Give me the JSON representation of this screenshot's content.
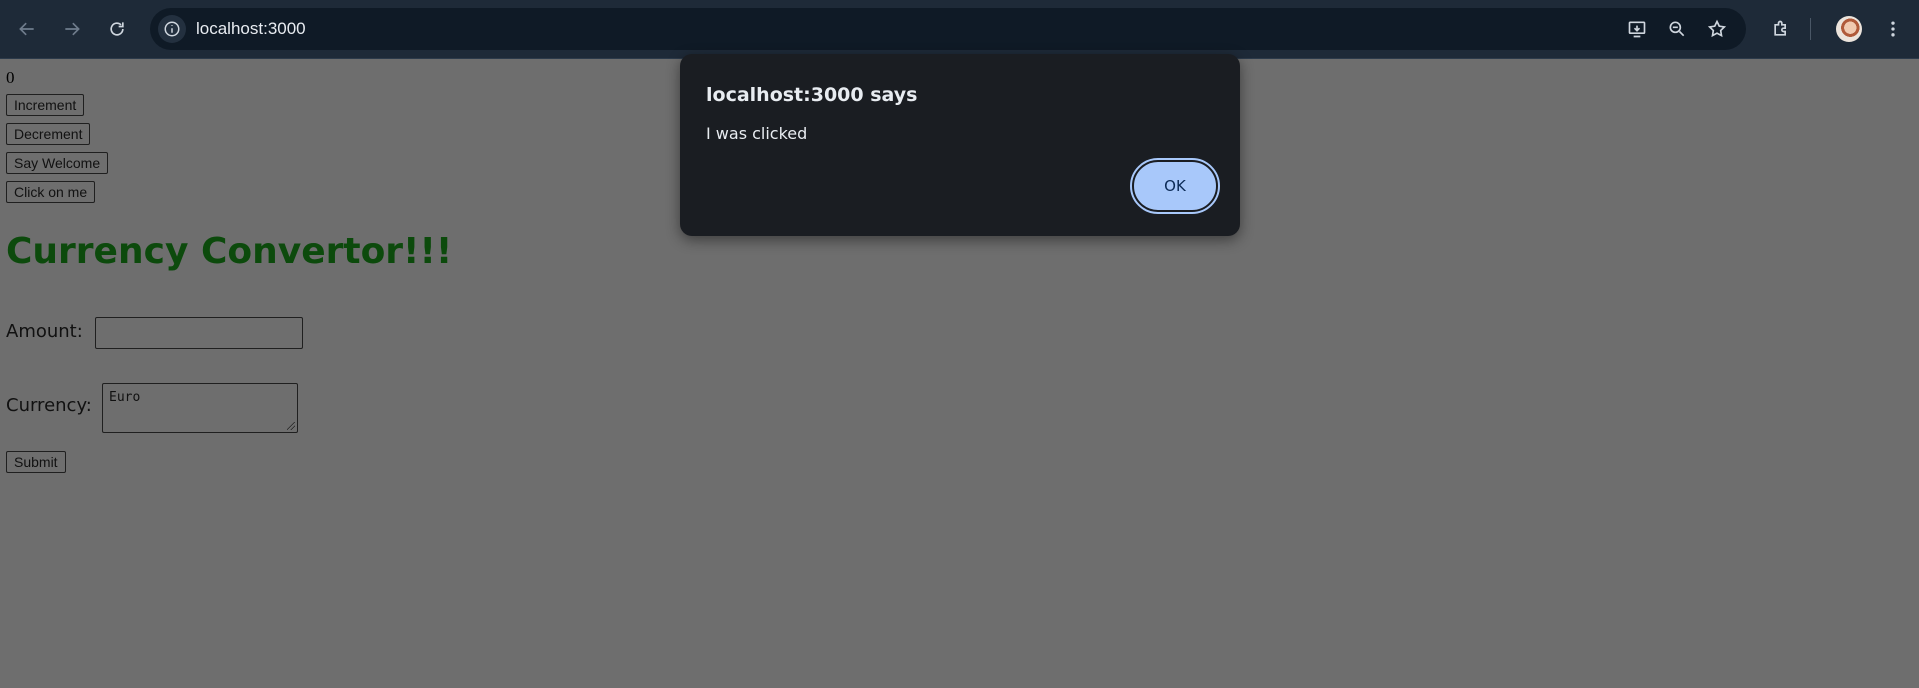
{
  "browser": {
    "url": "localhost:3000",
    "icons": {
      "back": "back-arrow-icon",
      "forward": "forward-arrow-icon",
      "reload": "reload-icon",
      "site_info": "info-icon",
      "install": "install-app-icon",
      "zoom": "zoom-out-icon",
      "bookmark": "star-icon",
      "extensions": "puzzle-icon",
      "menu": "more-vert-icon"
    }
  },
  "page": {
    "count": "0",
    "buttons": {
      "increment": "Increment",
      "decrement": "Decrement",
      "welcome": "Say Welcome",
      "click": "Click on me",
      "submit": "Submit"
    },
    "heading": "Currency Convertor!!!",
    "amount_label": "Amount:",
    "amount_value": "",
    "currency_label": "Currency:",
    "currency_value": "Euro"
  },
  "dialog": {
    "title": "localhost:3000 says",
    "message": "I was clicked",
    "ok_label": "OK"
  },
  "colors": {
    "heading": "#0c4a0c",
    "ok_button": "#a8c8fa",
    "chrome": "#1e2a38"
  }
}
